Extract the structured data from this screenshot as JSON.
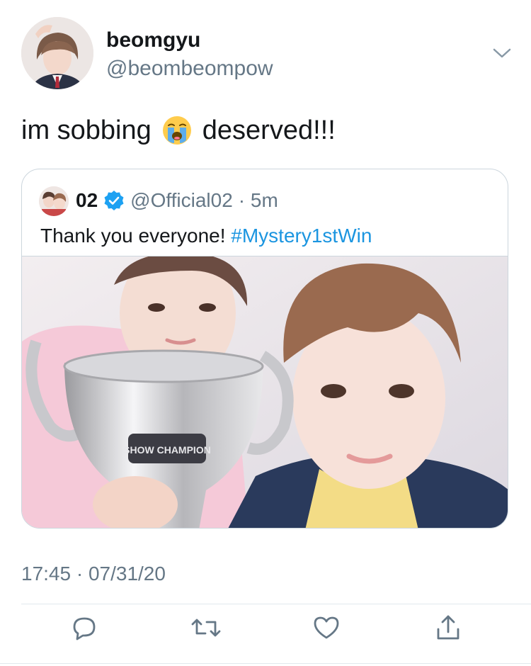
{
  "tweet": {
    "display_name": "beomgyu",
    "handle": "@beombeompow",
    "text_before": "im sobbing",
    "emoji": "loudly-crying-face",
    "text_after": "deserved!!!",
    "timestamp": "17:45 · 07/31/20"
  },
  "quoted": {
    "name": "02",
    "handle": "@Official02",
    "time": "· 5m",
    "text": "Thank you everyone!",
    "hashtag": "#Mystery1stWin",
    "image_trophy_text": "SHOW CHAMPION"
  },
  "actions": [
    "reply-icon",
    "retweet-icon",
    "like-icon",
    "share-icon"
  ],
  "colors": {
    "link": "#1b95e0",
    "secondary": "#657786",
    "verified": "#1da1f2"
  }
}
